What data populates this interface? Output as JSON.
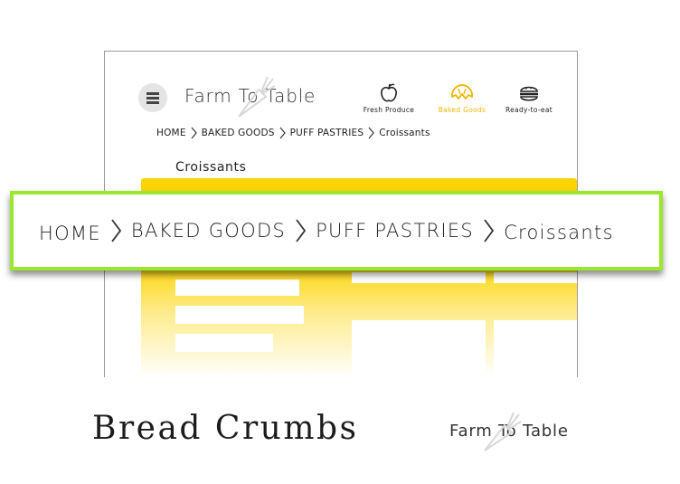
{
  "header": {
    "logo_text": "Farm To Table"
  },
  "nav": {
    "items": [
      {
        "label": "Fresh Produce",
        "icon": "apple-icon",
        "active": false
      },
      {
        "label": "Baked Goods",
        "icon": "croissant-icon",
        "active": true
      },
      {
        "label": "Ready-to-eat",
        "icon": "burger-icon",
        "active": false
      }
    ]
  },
  "breadcrumb": {
    "items": [
      "HOME",
      "BAKED GOODS",
      "PUFF PASTRIES",
      "Croissants"
    ],
    "separator": "chevron-right-icon"
  },
  "page": {
    "heading": "Croissants"
  },
  "callout": {
    "breadcrumb_items": [
      "HOME",
      "BAKED GOODS",
      "PUFF PASTRIES",
      "Croissants"
    ]
  },
  "footer": {
    "title": "Bread Crumbs",
    "logo_text": "Farm To Table"
  },
  "colors": {
    "accent": "#fbd400",
    "active_nav": "#f0b400",
    "highlight_border": "#9be62e"
  }
}
